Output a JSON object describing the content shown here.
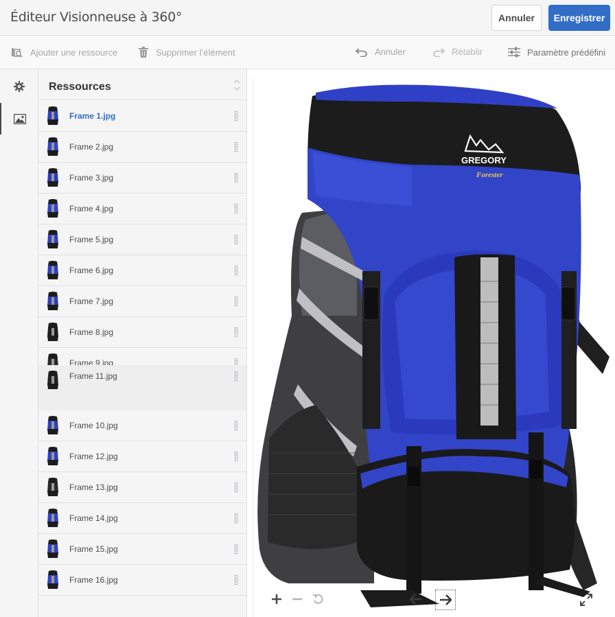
{
  "app": {
    "title": "Éditeur Visionneuse à 360°",
    "cancel_label": "Annuler",
    "save_label": "Enregistrer"
  },
  "toolbar": {
    "add_resource": "Ajouter une ressource",
    "delete_item": "Supprimer l’élément",
    "undo": "Annuler",
    "redo": "Rétablir",
    "preset": "Paramètre prédéfini"
  },
  "rail": {
    "settings_icon": "gear-icon",
    "resources_icon": "image-icon"
  },
  "panel": {
    "title": "Ressources",
    "items": [
      {
        "label": "Frame 1.jpg",
        "selected": true
      },
      {
        "label": "Frame 2.jpg"
      },
      {
        "label": "Frame 3.jpg"
      },
      {
        "label": "Frame 4.jpg"
      },
      {
        "label": "Frame 5.jpg"
      },
      {
        "label": "Frame 6.jpg"
      },
      {
        "label": "Frame 7.jpg"
      },
      {
        "label": "Frame 8.jpg"
      },
      {
        "label": "Frame 9.jpg"
      },
      {
        "label": "Frame 11.jpg",
        "dragging": true
      },
      {
        "label": "Frame 10.jpg"
      },
      {
        "label": "Frame 12.jpg"
      },
      {
        "label": "Frame 13.jpg"
      },
      {
        "label": "Frame 14.jpg"
      },
      {
        "label": "Frame 15.jpg"
      },
      {
        "label": "Frame 16.jpg"
      }
    ]
  },
  "viewer": {
    "brand": "GREGORY",
    "model": "Forester",
    "controls": [
      "zoom-in-icon",
      "zoom-out-icon",
      "reset-icon",
      "rotate-left-icon",
      "rotate-right-icon",
      "fullscreen-icon"
    ]
  },
  "colors": {
    "accent": "#326ec8",
    "pack_blue": "#2f3fc4",
    "pack_black": "#1c1c1c"
  }
}
